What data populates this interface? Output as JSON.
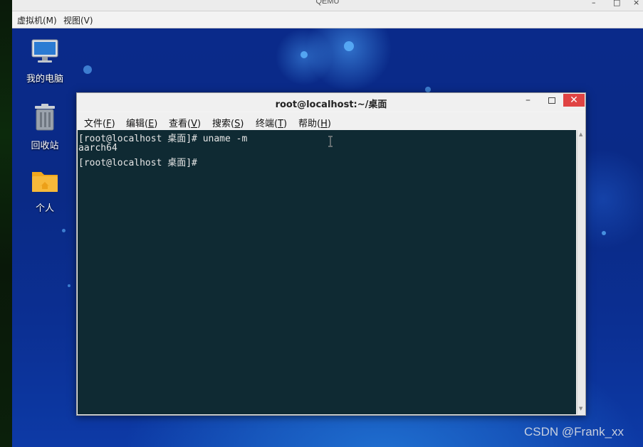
{
  "qemu": {
    "title": "QEMU",
    "controls": {
      "minimize": "–",
      "maximize": "□",
      "close": "×"
    },
    "menu": [
      "虚拟机(M)",
      "视图(V)"
    ]
  },
  "desktop": {
    "icons": [
      {
        "label": "我的电脑",
        "icon": "computer-icon"
      },
      {
        "label": "回收站",
        "icon": "trash-icon"
      },
      {
        "label": "个人",
        "icon": "home-folder-icon"
      }
    ]
  },
  "terminal": {
    "title": "root@localhost:~/桌面",
    "controls": {
      "minimize": "–",
      "close": "✕"
    },
    "menu": [
      {
        "text": "文件(",
        "key": "F",
        "end": ")"
      },
      {
        "text": "编辑(",
        "key": "E",
        "end": ")"
      },
      {
        "text": "查看(",
        "key": "V",
        "end": ")"
      },
      {
        "text": "搜索(",
        "key": "S",
        "end": ")"
      },
      {
        "text": "终端(",
        "key": "T",
        "end": ")"
      },
      {
        "text": "帮助(",
        "key": "H",
        "end": ")"
      }
    ],
    "lines": [
      "[root@localhost 桌面]# uname -m",
      "aarch64",
      "[root@localhost 桌面]#"
    ]
  },
  "watermark": "CSDN @Frank_xx",
  "colors": {
    "desktop_bg": "#0a2a8a",
    "terminal_bg": "#0f2a33",
    "close_red": "#e04343"
  }
}
